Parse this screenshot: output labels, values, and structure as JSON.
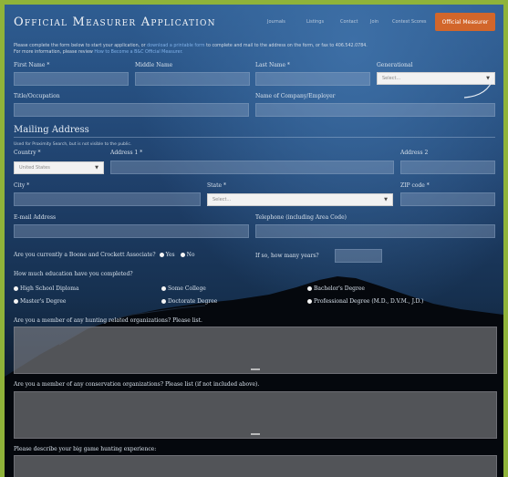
{
  "header": {
    "title": "Official Measurer Application",
    "nav": [
      "Journals",
      "Listings",
      "Contact",
      "Join",
      "Contest Scores"
    ],
    "cta": "Official Measurer"
  },
  "intro": {
    "line1_a": "Please complete the form below to start your application, or",
    "line1_link1": "download a printable form",
    "line1_b": "to complete and mail to the address on the form, or fax to 406.542.0784.",
    "line2_a": "For more information, please review",
    "line2_link": "How to Become a B&C Official Measurer."
  },
  "fields": {
    "first_name": "First Name *",
    "middle_name": "Middle Name",
    "last_name": "Last Name *",
    "generational": "Generational",
    "generational_value": "Select...",
    "title_occupation": "Title/Occupation",
    "company": "Name of Company/Employer"
  },
  "mailing": {
    "heading": "Mailing Address",
    "note": "Used for Proximity Search, but is not visible to the public.",
    "country": "Country *",
    "country_value": "United States",
    "address1": "Address 1 *",
    "address2": "Address 2",
    "city": "City *",
    "state": "State *",
    "state_value": "Select...",
    "zip": "ZIP code *",
    "email": "E-mail Address",
    "phone": "Telephone (including Area Code)"
  },
  "associate": {
    "question": "Are you currently a Boone and Crockett Associate?",
    "yes": "Yes",
    "no": "No",
    "years_label": "If so, how many years?"
  },
  "education": {
    "question": "How much education have you completed?",
    "options": [
      "High School Diploma",
      "Some College",
      "Bachelor's Degree",
      "Master's Degree",
      "Doctorate Degree",
      "Professional Degree (M.D., D.V.M., J.D.)"
    ]
  },
  "questions": {
    "hunting_orgs": "Are you a member of any hunting related organizations? Please list.",
    "conservation_orgs": "Are you a member of any conservation organizations? Please list (if not included above).",
    "big_game": "Please describe your big game hunting experience:"
  }
}
